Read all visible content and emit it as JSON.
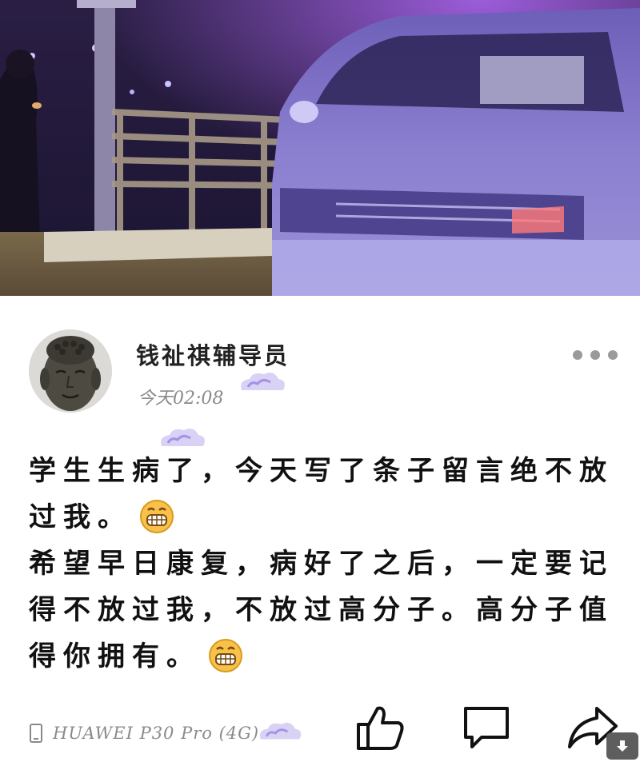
{
  "post": {
    "username": "钱祉祺辅导员",
    "timestamp": "今天02:08",
    "paragraph1": "学生生病了，今天写了条子留言绝不放过我。",
    "paragraph2": "希望早日康复，病好了之后，一定要记得不放过我，不放过高分子。高分子值得你拥有。",
    "device": "HUAWEI P30 Pro (4G)"
  },
  "icons": {
    "more": "more-dots-icon",
    "like": "thumbs-up-icon",
    "comment": "comment-icon",
    "share": "share-icon",
    "phone": "phone-icon",
    "emoji": "grin-emoji",
    "download": "download-arrow-icon"
  }
}
